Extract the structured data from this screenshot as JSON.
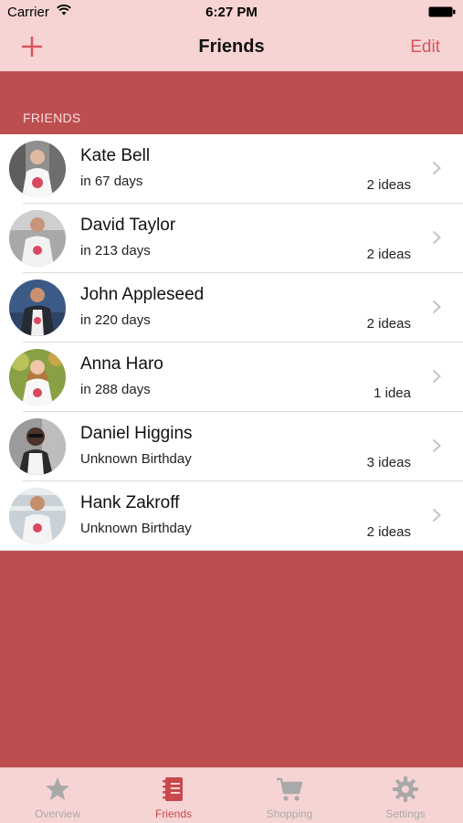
{
  "status": {
    "carrier": "Carrier",
    "time": "6:27 PM"
  },
  "nav": {
    "title": "Friends",
    "edit_label": "Edit",
    "add_icon": "plus-icon"
  },
  "section_title": "FRIENDS",
  "friends": [
    {
      "name": "Kate Bell",
      "subtitle": "in 67 days",
      "ideas": "2 ideas"
    },
    {
      "name": "David Taylor",
      "subtitle": "in 213 days",
      "ideas": "2 ideas"
    },
    {
      "name": "John Appleseed",
      "subtitle": "in 220 days",
      "ideas": "2 ideas"
    },
    {
      "name": "Anna Haro",
      "subtitle": "in 288 days",
      "ideas": "1 idea"
    },
    {
      "name": "Daniel Higgins",
      "subtitle": "Unknown Birthday",
      "ideas": "3 ideas"
    },
    {
      "name": "Hank Zakroff",
      "subtitle": "Unknown Birthday",
      "ideas": "2 ideas"
    }
  ],
  "tabs": [
    {
      "label": "Overview",
      "icon": "star-icon"
    },
    {
      "label": "Friends",
      "icon": "notebook-icon",
      "active": true
    },
    {
      "label": "Shopping",
      "icon": "cart-icon"
    },
    {
      "label": "Settings",
      "icon": "gear-icon"
    }
  ],
  "colors": {
    "accent": "#d9535a",
    "background_red": "#bd4e50",
    "bar_pink": "#f7d4d4",
    "tab_inactive": "#a9a9a9"
  }
}
